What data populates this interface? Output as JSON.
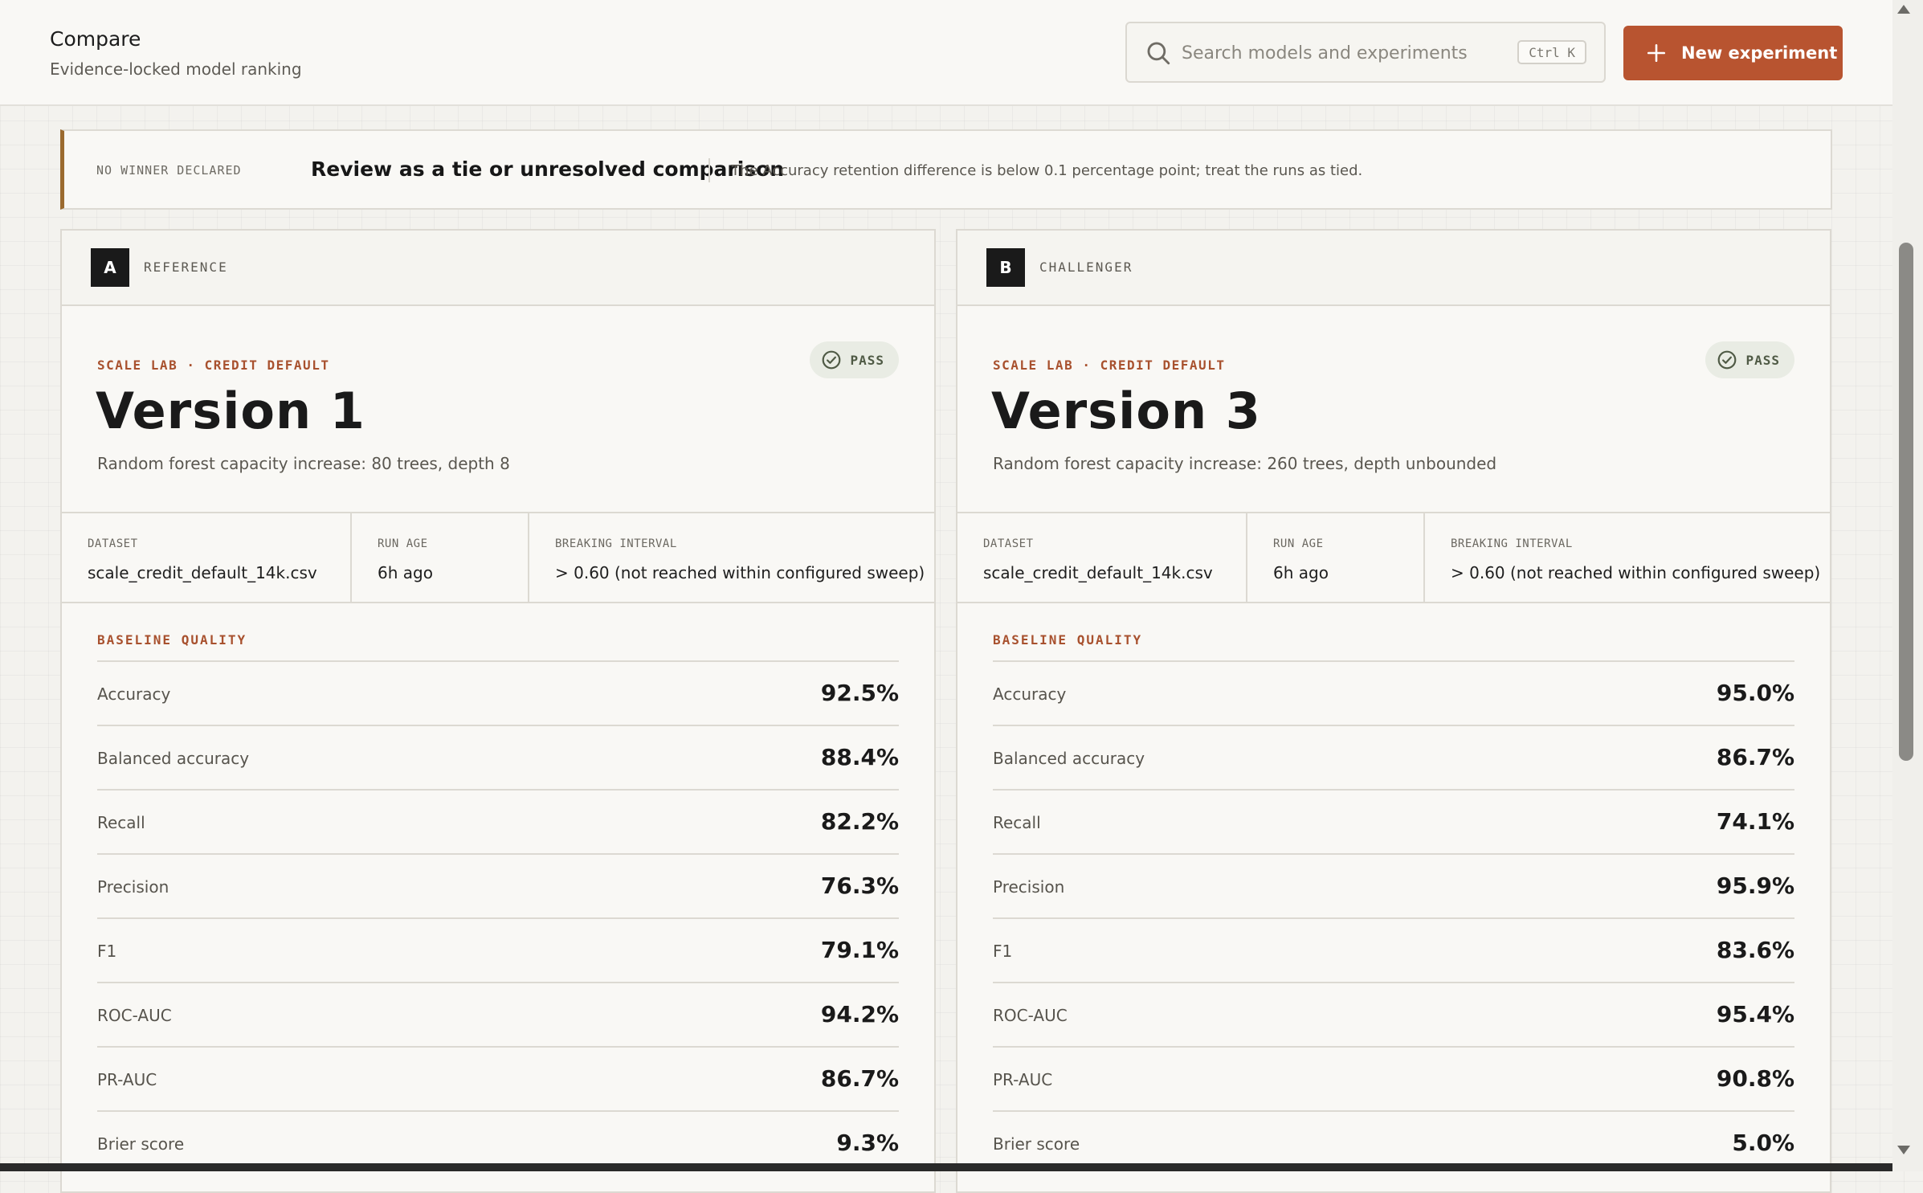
{
  "header": {
    "title": "Compare",
    "subtitle": "Evidence-locked model ranking",
    "search_placeholder": "Search models and experiments",
    "shortcut": "Ctrl K",
    "new_button_label": "New experiment",
    "accent_color": "#b85430"
  },
  "verdict": {
    "tag": "NO WINNER DECLARED",
    "title": "Review as a tie or unresolved comparison",
    "text": "The Accuracy retention difference is below 0.1 percentage point; treat the runs as tied."
  },
  "cards": [
    {
      "letter": "A",
      "role": "REFERENCE",
      "eyebrow": "SCALE LAB · CREDIT DEFAULT",
      "status": "PASS",
      "version": "Version 1",
      "description": "Random forest capacity increase: 80 trees, depth 8",
      "meta": [
        {
          "label": "DATASET",
          "value": "scale_credit_default_14k.csv"
        },
        {
          "label": "RUN AGE",
          "value": "6h ago"
        },
        {
          "label": "BREAKING INTERVAL",
          "value": "> 0.60 (not reached within configured sweep)"
        }
      ],
      "section_title": "BASELINE QUALITY",
      "metrics": [
        {
          "name": "Accuracy",
          "value": "92.5%"
        },
        {
          "name": "Balanced accuracy",
          "value": "88.4%"
        },
        {
          "name": "Recall",
          "value": "82.2%"
        },
        {
          "name": "Precision",
          "value": "76.3%"
        },
        {
          "name": "F1",
          "value": "79.1%"
        },
        {
          "name": "ROC-AUC",
          "value": "94.2%"
        },
        {
          "name": "PR-AUC",
          "value": "86.7%"
        },
        {
          "name": "Brier score",
          "value": "9.3%"
        }
      ]
    },
    {
      "letter": "B",
      "role": "CHALLENGER",
      "eyebrow": "SCALE LAB · CREDIT DEFAULT",
      "status": "PASS",
      "version": "Version 3",
      "description": "Random forest capacity increase: 260 trees, depth unbounded",
      "meta": [
        {
          "label": "DATASET",
          "value": "scale_credit_default_14k.csv"
        },
        {
          "label": "RUN AGE",
          "value": "6h ago"
        },
        {
          "label": "BREAKING INTERVAL",
          "value": "> 0.60 (not reached within configured sweep)"
        }
      ],
      "section_title": "BASELINE QUALITY",
      "metrics": [
        {
          "name": "Accuracy",
          "value": "95.0%"
        },
        {
          "name": "Balanced accuracy",
          "value": "86.7%"
        },
        {
          "name": "Recall",
          "value": "74.1%"
        },
        {
          "name": "Precision",
          "value": "95.9%"
        },
        {
          "name": "F1",
          "value": "83.6%"
        },
        {
          "name": "ROC-AUC",
          "value": "95.4%"
        },
        {
          "name": "PR-AUC",
          "value": "90.8%"
        },
        {
          "name": "Brier score",
          "value": "5.0%"
        }
      ]
    }
  ]
}
